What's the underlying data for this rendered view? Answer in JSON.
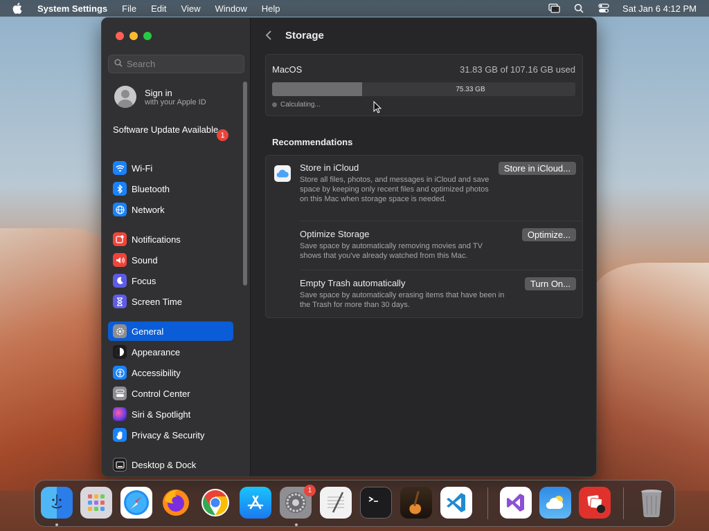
{
  "menubar": {
    "app_name": "System Settings",
    "menus": [
      "File",
      "Edit",
      "View",
      "Window",
      "Help"
    ],
    "clock": "Sat Jan 6  4:12 PM"
  },
  "sidebar": {
    "search_placeholder": "Search",
    "signin_title": "Sign in",
    "signin_subtitle": "with your Apple ID",
    "software_update": "Software Update Available",
    "software_update_badge": "1",
    "items": [
      {
        "label": "Wi-Fi",
        "color": "#1a82fb"
      },
      {
        "label": "Bluetooth",
        "color": "#1a82fb"
      },
      {
        "label": "Network",
        "color": "#1a82fb"
      },
      {
        "label": "Notifications",
        "color": "#f0443a"
      },
      {
        "label": "Sound",
        "color": "#f0443a"
      },
      {
        "label": "Focus",
        "color": "#5e5ce6"
      },
      {
        "label": "Screen Time",
        "color": "#5e5ce6"
      },
      {
        "label": "General",
        "color": "#8e8e93"
      },
      {
        "label": "Appearance",
        "color": "#1c1c1e"
      },
      {
        "label": "Accessibility",
        "color": "#1a82fb"
      },
      {
        "label": "Control Center",
        "color": "#8e8e93"
      },
      {
        "label": "Siri & Spotlight",
        "color": "#8b3fd6"
      },
      {
        "label": "Privacy & Security",
        "color": "#1a82fb"
      },
      {
        "label": "Desktop & Dock",
        "color": "#1c1c1e"
      }
    ]
  },
  "main": {
    "title": "Storage",
    "storage": {
      "volume": "MacOS",
      "used_text": "31.83 GB of 107.16 GB used",
      "used_fraction": 0.297,
      "free_label": "75.33 GB",
      "calculating": "Calculating..."
    },
    "recommendations_heading": "Recommendations",
    "recommendations": [
      {
        "title": "Store in iCloud",
        "desc": "Store all files, photos, and messages in iCloud and save space by keeping only recent files and optimized photos on this Mac when storage space is needed.",
        "button": "Store in iCloud..."
      },
      {
        "title": "Optimize Storage",
        "desc": "Save space by automatically removing movies and TV shows that you've already watched from this Mac.",
        "button": "Optimize..."
      },
      {
        "title": "Empty Trash automatically",
        "desc": "Save space by automatically erasing items that have been in the Trash for more than 30 days.",
        "button": "Turn On..."
      }
    ]
  },
  "dock": {
    "apps": [
      "finder-icon",
      "launchpad-icon",
      "safari-icon",
      "firefox-icon",
      "chrome-icon",
      "app-store-icon",
      "system-settings-icon",
      "textedit-icon",
      "terminal-icon",
      "garageband-icon",
      "vscode-icon",
      "visual-studio-icon",
      "weather-icon",
      "photo-booth-icon",
      "trash-icon"
    ],
    "settings_badge": "1"
  }
}
